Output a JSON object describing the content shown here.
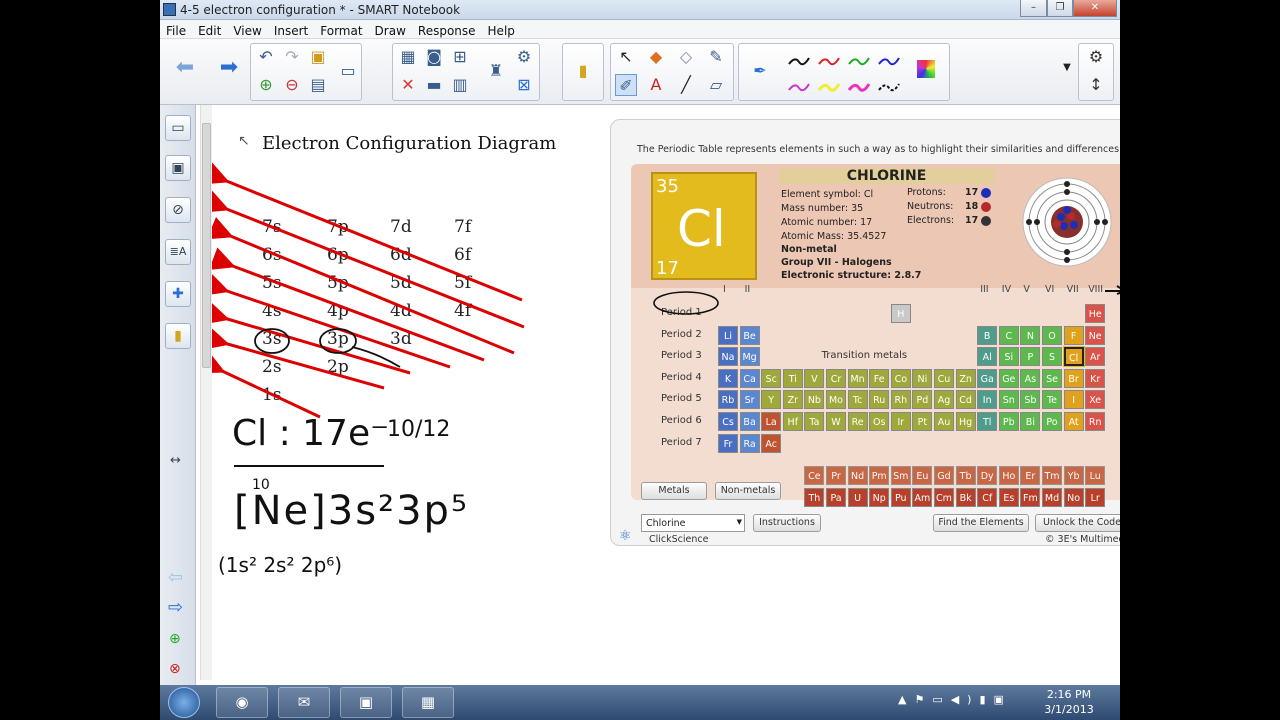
{
  "window": {
    "title": "4-5 electron configuration * - SMART Notebook"
  },
  "menu": [
    "File",
    "Edit",
    "View",
    "Insert",
    "Format",
    "Draw",
    "Response",
    "Help"
  ],
  "diagram": {
    "title": "Electron Configuration Diagram",
    "rows": [
      [
        "7s",
        "7p",
        "7d",
        "7f"
      ],
      [
        "6s",
        "6p",
        "6d",
        "6f"
      ],
      [
        "5s",
        "5p",
        "5d",
        "5f"
      ],
      [
        "4s",
        "4p",
        "4d",
        "4f"
      ],
      [
        "3s",
        "3p",
        "3d"
      ],
      [
        "2s",
        "2p"
      ],
      [
        "1s"
      ]
    ],
    "handwriting": {
      "line1": "Cl : 17e⁻",
      "count": "10/12",
      "line2": "[Ne]3s²3p⁵",
      "superscript": "10",
      "line3": "(1s² 2s² 2p⁶)"
    }
  },
  "widget": {
    "description": "The Periodic Table represents elements in such a way as to highlight their similarities and differences.",
    "element": {
      "name": "CHLORINE",
      "symbol": "Cl",
      "mass_number": "35",
      "atomic_number": "17",
      "info": {
        "symbol_line": "Element symbol: Cl",
        "mass_line": "Mass number: 35",
        "atomic_line": "Atomic number: 17",
        "amass_line": "Atomic Mass: 35.4527",
        "type": "Non-metal",
        "group": "Group VII - Halogens",
        "structure": "Electronic structure: 2.8.7"
      },
      "protons_label": "Protons:",
      "protons": "17",
      "neutrons_label": "Neutrons:",
      "neutrons": "18",
      "electrons_label": "Electrons:",
      "electrons": "17"
    },
    "group_labels_left": [
      "I",
      "II"
    ],
    "group_labels_right": [
      "III",
      "IV",
      "V",
      "VI",
      "VII",
      "VIII"
    ],
    "periods": [
      "Period 1",
      "Period 2",
      "Period 3",
      "Period 4",
      "Period 5",
      "Period 6",
      "Period 7"
    ],
    "transition_label": "Transition metals",
    "table": {
      "p1": [
        "H",
        "He"
      ],
      "p2": [
        "Li",
        "Be",
        "B",
        "C",
        "N",
        "O",
        "F",
        "Ne"
      ],
      "p3": [
        "Na",
        "Mg",
        "Al",
        "Si",
        "P",
        "S",
        "Cl",
        "Ar"
      ],
      "p4": [
        "K",
        "Ca",
        "Sc",
        "Ti",
        "V",
        "Cr",
        "Mn",
        "Fe",
        "Co",
        "Ni",
        "Cu",
        "Zn",
        "Ga",
        "Ge",
        "As",
        "Se",
        "Br",
        "Kr"
      ],
      "p5": [
        "Rb",
        "Sr",
        "Y",
        "Zr",
        "Nb",
        "Mo",
        "Tc",
        "Ru",
        "Rh",
        "Pd",
        "Ag",
        "Cd",
        "In",
        "Sn",
        "Sb",
        "Te",
        "I",
        "Xe"
      ],
      "p6": [
        "Cs",
        "Ba",
        "La",
        "Hf",
        "Ta",
        "W",
        "Re",
        "Os",
        "Ir",
        "Pt",
        "Au",
        "Hg",
        "Tl",
        "Pb",
        "Bi",
        "Po",
        "At",
        "Rn"
      ],
      "p7": [
        "Fr",
        "Ra",
        "Ac"
      ],
      "lanth": [
        "Ce",
        "Pr",
        "Nd",
        "Pm",
        "Sm",
        "Eu",
        "Gd",
        "Tb",
        "Dy",
        "Ho",
        "Er",
        "Tm",
        "Yb",
        "Lu"
      ],
      "actin": [
        "Th",
        "Pa",
        "U",
        "Np",
        "Pu",
        "Am",
        "Cm",
        "Bk",
        "Cf",
        "Es",
        "Fm",
        "Md",
        "No",
        "Lr"
      ]
    },
    "buttons": {
      "metals": "Metals",
      "nonmetals": "Non-metals",
      "instructions": "Instructions",
      "find": "Find the Elements",
      "unlock": "Unlock the Code"
    },
    "select_value": "Chlorine",
    "brand": "ClickScience",
    "copyright": "© 3E's Multimedia"
  },
  "taskbar": {
    "time": "2:16 PM",
    "date": "3/1/2013"
  },
  "colors": {
    "accent": "#e3bb1c",
    "arrow": "#dd0000"
  }
}
